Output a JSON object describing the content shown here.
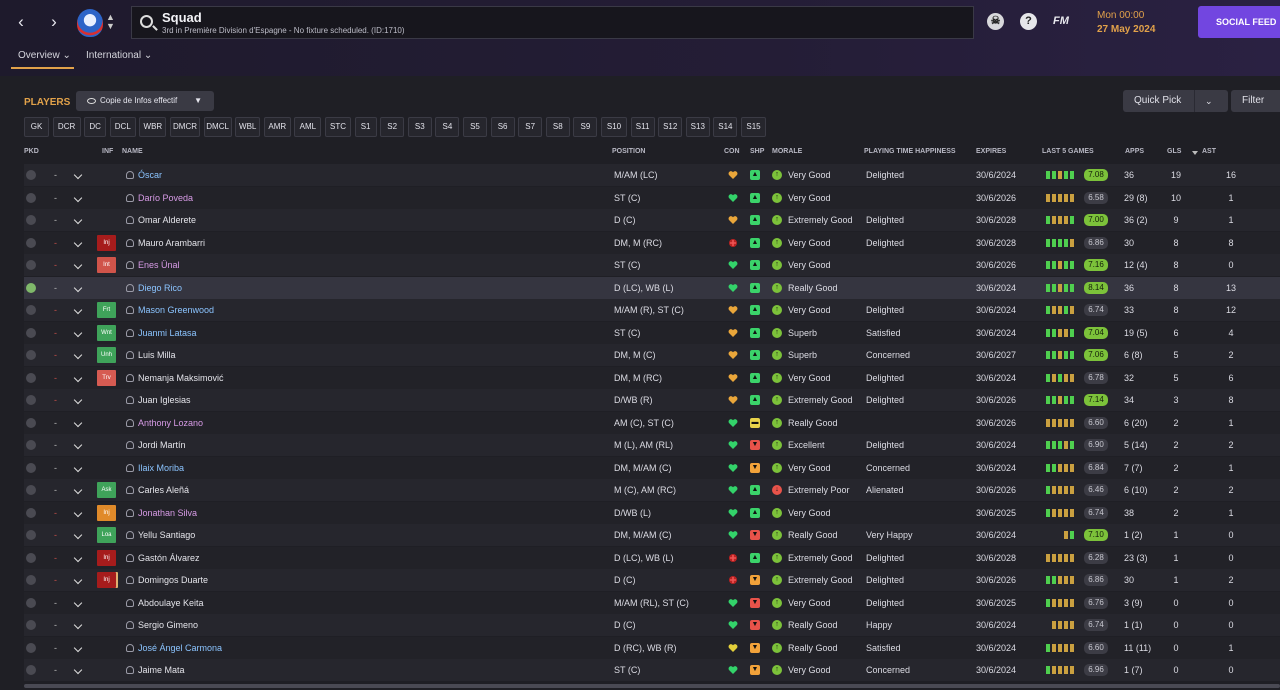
{
  "nav": {
    "back": "‹",
    "forward": "›"
  },
  "search": {
    "title": "Squad",
    "subtitle": "3rd in Première Division d'Espagne - No fixture scheduled. (ID:1710)"
  },
  "header": {
    "fm_label": "FM",
    "help_label": "?",
    "time": "Mon 00:00",
    "date": "27 May 2024",
    "social_feed": "SOCIAL FEED"
  },
  "tabs": [
    {
      "label": "Overview ⌄"
    },
    {
      "label": "International ⌄"
    }
  ],
  "players_title": "PLAYERS",
  "view_dropdown": "Copie de Infos effectif",
  "quick_pick": "Quick Pick",
  "filter": "Filter",
  "chips": [
    "GK",
    "DCR",
    "DC",
    "DCL",
    "WBR",
    "DMCR",
    "DMCL",
    "WBL",
    "AMR",
    "AML",
    "STC",
    "S1",
    "S2",
    "S3",
    "S4",
    "S5",
    "S6",
    "S7",
    "S8",
    "S9",
    "S10",
    "S11",
    "S12",
    "S13",
    "S14",
    "S15"
  ],
  "columns": {
    "pkd": "PKD",
    "inf": "INF",
    "name": "NAME",
    "position": "POSITION",
    "con": "CON",
    "shp": "SHP",
    "morale": "MORALE",
    "pth": "PLAYING TIME HAPPINESS",
    "expires": "EXPIRES",
    "last5": "LAST 5 GAMES",
    "apps": "APPS",
    "gls": "GLS",
    "ast": "AST"
  },
  "colors": {
    "accent": "#e2a24a",
    "social": "#7246e0",
    "rating_high": "#7cc23a",
    "link_blue": "#8bc4ff",
    "link_purple": "#d79be6"
  },
  "players": [
    {
      "name": "Óscar",
      "nc": "l",
      "inf": "",
      "ic": "",
      "pos": "M/AM (LC)",
      "con": "h-orange",
      "shp": "green",
      "mic": "green",
      "morale": "Very Good",
      "pth": "Delighted",
      "exp": "30/6/2024",
      "form": [
        "g",
        "g",
        "y",
        "g",
        "g"
      ],
      "rating": "7.08",
      "hi": true,
      "apps": "36",
      "gls": "19",
      "ast": "16",
      "pk": false,
      "dash": "w",
      "row": "alt"
    },
    {
      "name": "Darío Poveda",
      "nc": "p",
      "inf": "",
      "ic": "",
      "pos": "ST (C)",
      "con": "h-green",
      "shp": "green",
      "mic": "green",
      "morale": "Very Good",
      "pth": "",
      "exp": "30/6/2026",
      "form": [
        "y",
        "y",
        "y",
        "y",
        "y"
      ],
      "rating": "6.58",
      "hi": false,
      "apps": "29 (8)",
      "gls": "10",
      "ast": "1",
      "pk": false,
      "dash": "w",
      "row": "base"
    },
    {
      "name": "Omar Alderete",
      "nc": "w",
      "inf": "",
      "ic": "",
      "pos": "D (C)",
      "con": "h-orange",
      "shp": "green",
      "mic": "green",
      "morale": "Extremely Good",
      "pth": "Delighted",
      "exp": "30/6/2028",
      "form": [
        "g",
        "y",
        "y",
        "y",
        "g"
      ],
      "rating": "7.00",
      "hi": true,
      "apps": "36 (2)",
      "gls": "9",
      "ast": "1",
      "pk": false,
      "dash": "w",
      "row": "alt"
    },
    {
      "name": "Mauro Arambarri",
      "nc": "w",
      "inf": "Inj",
      "ic": "b-inj",
      "pos": "DM, M (RC)",
      "con": "cross",
      "shp": "green",
      "mic": "green",
      "morale": "Very Good",
      "pth": "Delighted",
      "exp": "30/6/2028",
      "form": [
        "g",
        "g",
        "g",
        "g",
        "y"
      ],
      "rating": "6.86",
      "hi": false,
      "apps": "30",
      "gls": "8",
      "ast": "8",
      "pk": false,
      "dash": "r",
      "row": "base"
    },
    {
      "name": "Enes Ünal",
      "nc": "p",
      "inf": "Int",
      "ic": "b-int",
      "pos": "ST (C)",
      "con": "h-green",
      "shp": "green",
      "mic": "green",
      "morale": "Very Good",
      "pth": "",
      "exp": "30/6/2026",
      "form": [
        "g",
        "g",
        "y",
        "g",
        "g"
      ],
      "rating": "7.16",
      "hi": true,
      "apps": "12 (4)",
      "gls": "8",
      "ast": "0",
      "pk": false,
      "dash": "r",
      "row": "alt"
    },
    {
      "name": "Diego Rico",
      "nc": "l",
      "inf": "",
      "ic": "",
      "pos": "D (LC), WB (L)",
      "con": "h-green",
      "shp": "green",
      "mic": "green",
      "morale": "Really Good",
      "pth": "",
      "exp": "30/6/2024",
      "form": [
        "g",
        "g",
        "y",
        "g",
        "g"
      ],
      "rating": "8.14",
      "hi": true,
      "apps": "36",
      "gls": "8",
      "ast": "13",
      "pk": true,
      "dash": "w",
      "row": "hl"
    },
    {
      "name": "Mason Greenwood",
      "nc": "l",
      "inf": "Frt",
      "ic": "b-ok",
      "pos": "M/AM (R), ST (C)",
      "con": "h-orange",
      "shp": "green",
      "mic": "green",
      "morale": "Very Good",
      "pth": "Delighted",
      "exp": "30/6/2024",
      "form": [
        "g",
        "y",
        "y",
        "g",
        "y"
      ],
      "rating": "6.74",
      "hi": false,
      "apps": "33",
      "gls": "8",
      "ast": "12",
      "pk": false,
      "dash": "r",
      "row": "alt"
    },
    {
      "name": "Juanmi Latasa",
      "nc": "l",
      "inf": "Wnt",
      "ic": "b-ok",
      "pos": "ST (C)",
      "con": "h-orange",
      "shp": "green",
      "mic": "green",
      "morale": "Superb",
      "pth": "Satisfied",
      "exp": "30/6/2024",
      "form": [
        "g",
        "g",
        "y",
        "y",
        "g"
      ],
      "rating": "7.04",
      "hi": true,
      "apps": "19 (5)",
      "gls": "6",
      "ast": "4",
      "pk": false,
      "dash": "r",
      "row": "base"
    },
    {
      "name": "Luis Milla",
      "nc": "w",
      "inf": "Unh",
      "ic": "b-ok",
      "pos": "DM, M (C)",
      "con": "h-orange",
      "shp": "green",
      "mic": "green",
      "morale": "Superb",
      "pth": "Concerned",
      "exp": "30/6/2027",
      "form": [
        "g",
        "g",
        "y",
        "g",
        "g"
      ],
      "rating": "7.06",
      "hi": true,
      "apps": "6 (8)",
      "gls": "5",
      "ast": "2",
      "pk": false,
      "dash": "r",
      "row": "alt"
    },
    {
      "name": "Nemanja Maksimović",
      "nc": "w",
      "inf": "Trv",
      "ic": "b-tv",
      "pos": "DM, M (RC)",
      "con": "h-orange",
      "shp": "green",
      "mic": "green",
      "morale": "Very Good",
      "pth": "Delighted",
      "exp": "30/6/2024",
      "form": [
        "g",
        "y",
        "g",
        "y",
        "y"
      ],
      "rating": "6.78",
      "hi": false,
      "apps": "32",
      "gls": "5",
      "ast": "6",
      "pk": false,
      "dash": "r",
      "row": "base"
    },
    {
      "name": "Juan Iglesias",
      "nc": "w",
      "inf": "",
      "ic": "",
      "pos": "D/WB (R)",
      "con": "h-orange",
      "shp": "green",
      "mic": "green",
      "morale": "Extremely Good",
      "pth": "Delighted",
      "exp": "30/6/2026",
      "form": [
        "g",
        "g",
        "y",
        "g",
        "g"
      ],
      "rating": "7.14",
      "hi": true,
      "apps": "34",
      "gls": "3",
      "ast": "8",
      "pk": false,
      "dash": "r",
      "row": "alt"
    },
    {
      "name": "Anthony Lozano",
      "nc": "p",
      "inf": "",
      "ic": "",
      "pos": "AM (C), ST (C)",
      "con": "h-green",
      "shp": "yellow",
      "mic": "green",
      "morale": "Really Good",
      "pth": "",
      "exp": "30/6/2026",
      "form": [
        "y",
        "y",
        "y",
        "y",
        "y"
      ],
      "rating": "6.60",
      "hi": false,
      "apps": "6 (20)",
      "gls": "2",
      "ast": "1",
      "pk": false,
      "dash": "w",
      "row": "base"
    },
    {
      "name": "Jordi Martín",
      "nc": "w",
      "inf": "",
      "ic": "",
      "pos": "M (L), AM (RL)",
      "con": "h-green",
      "shp": "red",
      "mic": "green",
      "morale": "Excellent",
      "pth": "Delighted",
      "exp": "30/6/2024",
      "form": [
        "g",
        "g",
        "g",
        "y",
        "g"
      ],
      "rating": "6.90",
      "hi": false,
      "apps": "5 (14)",
      "gls": "2",
      "ast": "2",
      "pk": false,
      "dash": "w",
      "row": "alt"
    },
    {
      "name": "Ilaix Moriba",
      "nc": "l",
      "inf": "",
      "ic": "",
      "pos": "DM, M/AM (C)",
      "con": "h-green",
      "shp": "orange",
      "mic": "green",
      "morale": "Very Good",
      "pth": "Concerned",
      "exp": "30/6/2024",
      "form": [
        "g",
        "g",
        "y",
        "y",
        "y"
      ],
      "rating": "6.84",
      "hi": false,
      "apps": "7 (7)",
      "gls": "2",
      "ast": "1",
      "pk": false,
      "dash": "w",
      "row": "base"
    },
    {
      "name": "Carles Aleñá",
      "nc": "w",
      "inf": "Ask",
      "ic": "b-ok",
      "pos": "M (C), AM (RC)",
      "con": "h-green",
      "shp": "green",
      "mic": "red",
      "morale": "Extremely Poor",
      "pth": "Alienated",
      "exp": "30/6/2026",
      "form": [
        "g",
        "y",
        "y",
        "y",
        "y"
      ],
      "rating": "6.46",
      "hi": false,
      "apps": "6 (10)",
      "gls": "2",
      "ast": "2",
      "pk": false,
      "dash": "w",
      "row": "alt"
    },
    {
      "name": "Jonathan Silva",
      "nc": "p",
      "inf": "Inj",
      "ic": "b-inj3",
      "pos": "D/WB (L)",
      "con": "h-green",
      "shp": "green",
      "mic": "green",
      "morale": "Very Good",
      "pth": "",
      "exp": "30/6/2025",
      "form": [
        "g",
        "y",
        "y",
        "y",
        "y"
      ],
      "rating": "6.74",
      "hi": false,
      "apps": "38",
      "gls": "2",
      "ast": "1",
      "pk": false,
      "dash": "r",
      "row": "base"
    },
    {
      "name": "Yellu Santiago",
      "nc": "w",
      "inf": "Loa",
      "ic": "b-ok",
      "pos": "DM, M/AM (C)",
      "con": "h-green",
      "shp": "red",
      "mic": "green",
      "morale": "Really Good",
      "pth": "Very Happy",
      "exp": "30/6/2024",
      "form": [
        "y",
        "g"
      ],
      "rating": "7.10",
      "hi": true,
      "apps": "1 (2)",
      "gls": "1",
      "ast": "0",
      "pk": false,
      "dash": "r",
      "row": "alt"
    },
    {
      "name": "Gastón Álvarez",
      "nc": "w",
      "inf": "Inj",
      "ic": "b-inj",
      "pos": "D (LC), WB (L)",
      "con": "cross",
      "shp": "green",
      "mic": "green",
      "morale": "Extremely Good",
      "pth": "Delighted",
      "exp": "30/6/2028",
      "form": [
        "y",
        "y",
        "y",
        "y",
        "y"
      ],
      "rating": "6.28",
      "hi": false,
      "apps": "23 (3)",
      "gls": "1",
      "ast": "0",
      "pk": false,
      "dash": "r",
      "row": "base"
    },
    {
      "name": "Domingos Duarte",
      "nc": "w",
      "inf": "Inj",
      "ic": "b-inj2",
      "pos": "D (C)",
      "con": "cross",
      "shp": "orange",
      "mic": "green",
      "morale": "Extremely Good",
      "pth": "Delighted",
      "exp": "30/6/2026",
      "form": [
        "g",
        "g",
        "y",
        "y",
        "y"
      ],
      "rating": "6.86",
      "hi": false,
      "apps": "30",
      "gls": "1",
      "ast": "2",
      "pk": false,
      "dash": "r",
      "row": "alt"
    },
    {
      "name": "Abdoulaye Keita",
      "nc": "w",
      "inf": "",
      "ic": "",
      "pos": "M/AM (RL), ST (C)",
      "con": "h-green",
      "shp": "red",
      "mic": "green",
      "morale": "Very Good",
      "pth": "Delighted",
      "exp": "30/6/2025",
      "form": [
        "g",
        "y",
        "y",
        "y",
        "y"
      ],
      "rating": "6.76",
      "hi": false,
      "apps": "3 (9)",
      "gls": "0",
      "ast": "0",
      "pk": false,
      "dash": "w",
      "row": "base"
    },
    {
      "name": "Sergio Gimeno",
      "nc": "w",
      "inf": "",
      "ic": "",
      "pos": "D (C)",
      "con": "h-green",
      "shp": "red",
      "mic": "green",
      "morale": "Really Good",
      "pth": "Happy",
      "exp": "30/6/2024",
      "form": [
        "y",
        "y",
        "y",
        "y"
      ],
      "rating": "6.74",
      "hi": false,
      "apps": "1 (1)",
      "gls": "0",
      "ast": "0",
      "pk": false,
      "dash": "w",
      "row": "alt"
    },
    {
      "name": "José Ángel Carmona",
      "nc": "l",
      "inf": "",
      "ic": "",
      "pos": "D (RC), WB (R)",
      "con": "h-yellow",
      "shp": "orange",
      "mic": "green",
      "morale": "Really Good",
      "pth": "Satisfied",
      "exp": "30/6/2024",
      "form": [
        "g",
        "y",
        "y",
        "y",
        "y"
      ],
      "rating": "6.60",
      "hi": false,
      "apps": "11 (11)",
      "gls": "0",
      "ast": "1",
      "pk": false,
      "dash": "w",
      "row": "base"
    },
    {
      "name": "Jaime Mata",
      "nc": "w",
      "inf": "",
      "ic": "",
      "pos": "ST (C)",
      "con": "h-green",
      "shp": "orange",
      "mic": "green",
      "morale": "Very Good",
      "pth": "Concerned",
      "exp": "30/6/2024",
      "form": [
        "g",
        "y",
        "y",
        "y",
        "y"
      ],
      "rating": "6.96",
      "hi": false,
      "apps": "1 (7)",
      "gls": "0",
      "ast": "0",
      "pk": false,
      "dash": "w",
      "row": "alt"
    }
  ]
}
